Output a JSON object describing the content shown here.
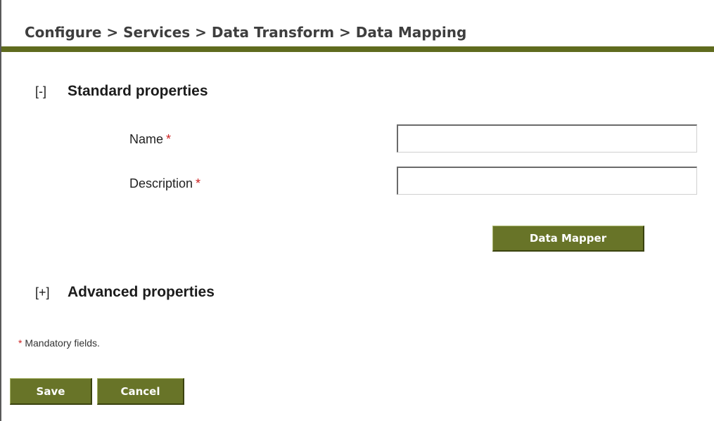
{
  "breadcrumb": {
    "text": "Configure > Services > Data Transform > Data Mapping"
  },
  "standard_section": {
    "toggle": "[-]",
    "title": "Standard properties"
  },
  "fields": {
    "name": {
      "label": "Name",
      "required_mark": "*",
      "value": ""
    },
    "description": {
      "label": "Description",
      "required_mark": "*",
      "value": ""
    }
  },
  "data_mapper_button": {
    "label": "Data Mapper"
  },
  "advanced_section": {
    "toggle": "[+]",
    "title": "Advanced properties"
  },
  "mandatory_note": {
    "mark": "*",
    "text": " Mandatory fields."
  },
  "footer": {
    "save_label": "Save",
    "cancel_label": "Cancel"
  },
  "colors": {
    "accent": "#5f6b1e",
    "button": "#687428",
    "required": "#cc2222"
  }
}
